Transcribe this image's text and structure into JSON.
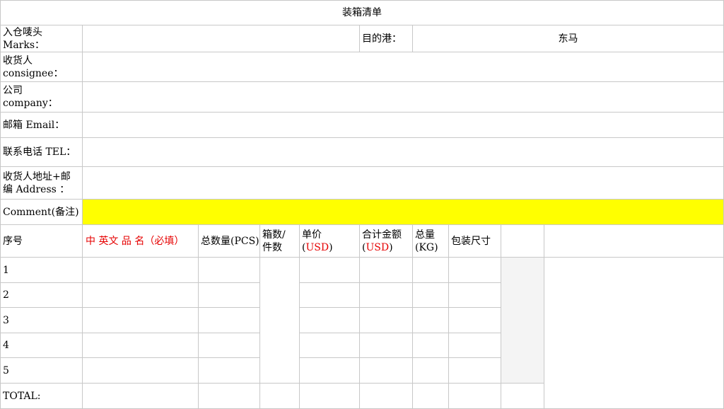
{
  "title": "装箱清单",
  "marks": {
    "label_cn": "入仓唛头",
    "label_en": "Marks："
  },
  "port": {
    "label": "目的港：",
    "value": "东马"
  },
  "consignee": {
    "label_cn": "收货人",
    "label_en": "consignee："
  },
  "company": {
    "label_cn": "公司",
    "label_en": "company："
  },
  "email": {
    "label": "邮箱 Email："
  },
  "tel": {
    "label": "联系电话 TEL："
  },
  "address": {
    "label_line1": "收货人地址+邮",
    "label_line2": "编 Address ："
  },
  "comment": {
    "label": "Comment(备注)",
    "highlight_color": "#ffff00"
  },
  "table": {
    "headers": {
      "seq": "序号",
      "name": "中 英文 品 名（必填）",
      "qty": "总数量(PCS)",
      "boxes_1": "箱数/",
      "boxes_2": "件数",
      "unit_price_1": "单价",
      "unit_price_2a": "(",
      "unit_price_2b": "USD",
      "unit_price_2c": ")",
      "amount_1": "合计金额",
      "amount_2a": "(",
      "amount_2b": "USD",
      "amount_2c": ")",
      "weight_1": "总量",
      "weight_2": "(KG)",
      "size": "包装尺寸"
    },
    "rows": [
      "1",
      "2",
      "3",
      "4",
      "5"
    ],
    "total_label": "TOTAL:"
  },
  "accent_red": "#e60000"
}
